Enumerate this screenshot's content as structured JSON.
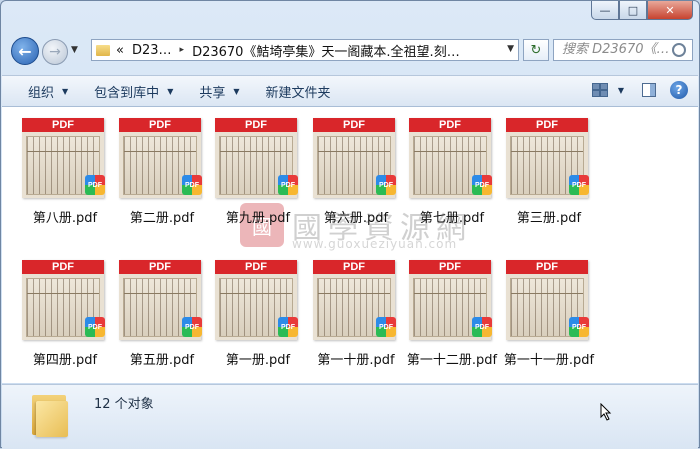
{
  "window": {
    "caption_buttons": {
      "minimize": "—",
      "maximize": "□",
      "close": "✕"
    }
  },
  "nav": {
    "back_icon": "←",
    "forward_icon": "→",
    "history_icon": "▼",
    "address_prefix": "«",
    "crumb1": "D23…",
    "crumb_sep": "▸",
    "crumb2": "D23670《鮚埼亭集》天一阁藏本.全祖望.刻…",
    "address_dropdown": "▼",
    "refresh_icon": "↻",
    "search_placeholder": "搜索 D23670《…"
  },
  "toolbar": {
    "organize": "组织",
    "include_library": "包含到库中",
    "share": "共享",
    "new_folder": "新建文件夹",
    "arrow": "▼",
    "help": "?"
  },
  "files": [
    {
      "name": "第八册.pdf"
    },
    {
      "name": "第二册.pdf"
    },
    {
      "name": "第九册.pdf"
    },
    {
      "name": "第六册.pdf"
    },
    {
      "name": "第七册.pdf"
    },
    {
      "name": "第三册.pdf"
    },
    {
      "name": "第四册.pdf"
    },
    {
      "name": "第五册.pdf"
    },
    {
      "name": "第一册.pdf"
    },
    {
      "name": "第一十册.pdf"
    },
    {
      "name": "第一十二册.pdf"
    },
    {
      "name": "第一十一册.pdf"
    }
  ],
  "thumb_band": "PDF",
  "thumb_badge": "PDF",
  "watermark": {
    "seal": "國",
    "text": "國學資源網",
    "url": "www.guoxueziyuan.com"
  },
  "status": {
    "item_count": "12 个对象"
  }
}
